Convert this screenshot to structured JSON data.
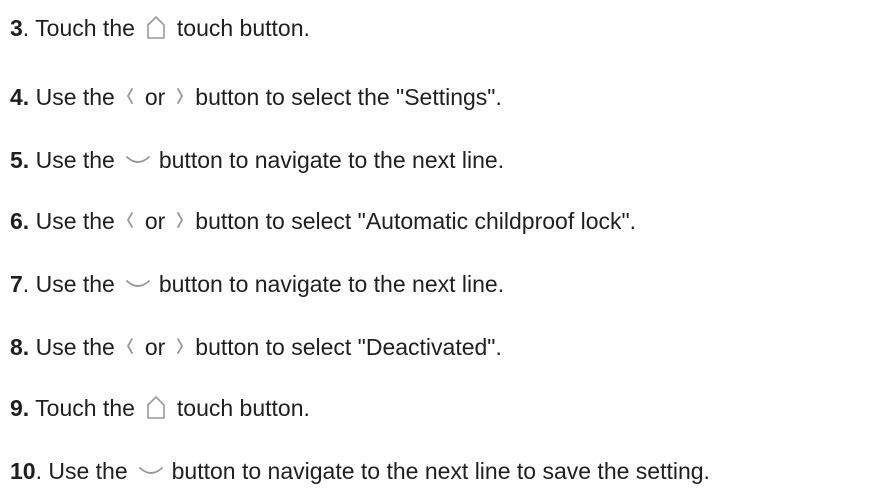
{
  "steps": [
    {
      "num": "3",
      "suffix": ".",
      "parts": [
        {
          "t": "text",
          "v": " Touch the"
        },
        {
          "t": "icon",
          "icon": "home-icon"
        },
        {
          "t": "text",
          "v": "touch button."
        }
      ]
    },
    {
      "num": "4.",
      "suffix": "",
      "parts": [
        {
          "t": "text",
          "v": " Use the"
        },
        {
          "t": "icon",
          "icon": "chevron-left-icon"
        },
        {
          "t": "text",
          "v": "or"
        },
        {
          "t": "icon",
          "icon": "chevron-right-icon"
        },
        {
          "t": "text",
          "v": "button to select the \"Settings\"."
        }
      ]
    },
    {
      "num": "5.",
      "suffix": "",
      "parts": [
        {
          "t": "text",
          "v": " Use the"
        },
        {
          "t": "icon",
          "icon": "chevron-down-icon"
        },
        {
          "t": "text",
          "v": "button to navigate to the next line."
        }
      ]
    },
    {
      "num": "6.",
      "suffix": "",
      "parts": [
        {
          "t": "text",
          "v": " Use the"
        },
        {
          "t": "icon",
          "icon": "chevron-left-icon"
        },
        {
          "t": "text",
          "v": "or"
        },
        {
          "t": "icon",
          "icon": "chevron-right-icon"
        },
        {
          "t": "text",
          "v": "button to select \"Automatic childproof lock\"."
        }
      ]
    },
    {
      "num": "7",
      "suffix": ".",
      "parts": [
        {
          "t": "text",
          "v": " Use the"
        },
        {
          "t": "icon",
          "icon": "chevron-down-icon"
        },
        {
          "t": "text",
          "v": "button to navigate to the next line."
        }
      ]
    },
    {
      "num": "8.",
      "suffix": "",
      "parts": [
        {
          "t": "text",
          "v": " Use the"
        },
        {
          "t": "icon",
          "icon": "chevron-left-icon"
        },
        {
          "t": "text",
          "v": "or"
        },
        {
          "t": "icon",
          "icon": "chevron-right-icon"
        },
        {
          "t": "text",
          "v": "button to select \"Deactivated\"."
        }
      ]
    },
    {
      "num": "9.",
      "suffix": "",
      "parts": [
        {
          "t": "text",
          "v": " Touch the"
        },
        {
          "t": "icon",
          "icon": "home-icon"
        },
        {
          "t": "text",
          "v": "touch button."
        }
      ]
    },
    {
      "num": "10",
      "suffix": ".",
      "parts": [
        {
          "t": "text",
          "v": " Use the"
        },
        {
          "t": "icon",
          "icon": "chevron-down-icon"
        },
        {
          "t": "text",
          "v": "button to navigate to the next line to save the setting."
        }
      ]
    }
  ],
  "colors": {
    "text": "#1f1f1f",
    "icon": "#9a9a9a"
  }
}
